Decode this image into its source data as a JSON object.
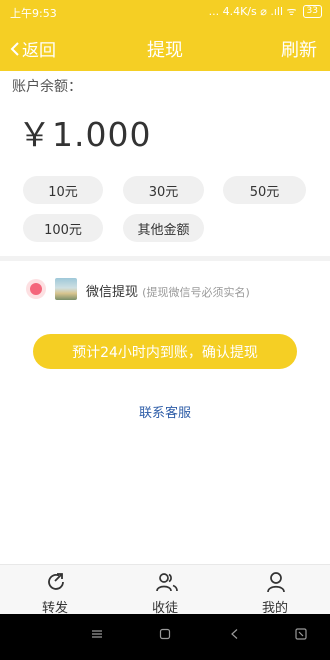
{
  "status_bar": {
    "time": "上午9:53",
    "right_text": "... 4.4K/s ⌀ .ıll ᯤ",
    "battery": "33"
  },
  "nav": {
    "back_label": "返回",
    "title": "提现",
    "refresh_label": "刷新"
  },
  "balance": {
    "label": "账户余额：",
    "value": "￥1.000"
  },
  "amounts": [
    "10元",
    "30元",
    "50元",
    "100元",
    "其他金额"
  ],
  "withdraw_method": {
    "name": "微信提现",
    "note": "(提现微信号必须实名)"
  },
  "confirm_button": "预计24小时内到账，确认提现",
  "contact_link": "联系客服",
  "tabs": [
    {
      "label": "转发",
      "icon": "share-icon"
    },
    {
      "label": "收徒",
      "icon": "users-icon"
    },
    {
      "label": "我的",
      "icon": "user-icon"
    }
  ],
  "colors": {
    "accent": "#f5cf24",
    "link": "#2f5ea8",
    "radio": "#f4667b"
  }
}
